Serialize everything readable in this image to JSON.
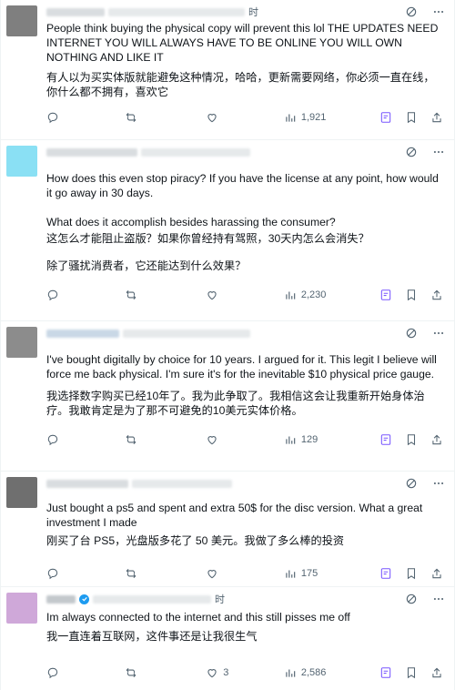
{
  "colors": {
    "icon": "#536471",
    "grok_highlight": "#7856ff",
    "verified": "#1d9bf0",
    "avatar_1": "#7f7f7f",
    "avatar_2": "#8ae0f4",
    "avatar_3": "#8c8c8c",
    "avatar_4": "#6f6f6f",
    "avatar_5": "#cfa8d9"
  },
  "icons": {
    "reply": "reply-icon",
    "repost": "repost-icon",
    "like": "like-icon",
    "views": "views-icon",
    "grok": "grok-icon",
    "bookmark": "bookmark-icon",
    "share": "share-icon",
    "more": "more-icon"
  },
  "posts": [
    {
      "header_suffix": "时",
      "verified": false,
      "lines": [
        "People think buying the physical copy will prevent this lol THE UPDATES NEED INTERNET YOU WILL ALWAYS HAVE TO BE ONLINE YOU WILL OWN NOTHING AND LIKE IT",
        "有人以为买实体版就能避免这种情况，哈哈，更新需要网络，你必须一直在线，你什么都不拥有，喜欢它"
      ],
      "likes": "",
      "views": "1,921"
    },
    {
      "header_suffix": "",
      "verified": false,
      "lines": [
        "How does this even stop piracy? If you have the license at any point, how would it go away in 30 days.",
        "What does it accomplish besides harassing the consumer?",
        "这怎么才能阻止盗版？如果你曾经持有驾照，30天内怎么会消失？",
        "除了骚扰消费者，它还能达到什么效果？"
      ],
      "likes": "",
      "views": "2,230"
    },
    {
      "header_suffix": "",
      "verified": false,
      "lines": [
        "I've bought digitally by choice for 10 years. I argued for it. This legit I believe will force me back physical. I'm sure it's for the inevitable $10 physical price gauge.",
        "我选择数字购买已经10年了。我为此争取了。我相信这会让我重新开始身体治疗。我敢肯定是为了那不可避免的10美元实体价格。"
      ],
      "likes": "",
      "views": "129"
    },
    {
      "header_suffix": "",
      "verified": false,
      "lines": [
        "Just bought a ps5 and spent and extra 50$ for the disc version. What a great investment I made",
        "刚买了台 PS5，光盘版多花了 50 美元。我做了多么棒的投资"
      ],
      "likes": "",
      "views": "175"
    },
    {
      "header_suffix": "时",
      "verified": true,
      "lines": [
        "Im always connected to the internet and this still pisses me off",
        "我一直连着互联网，这件事还是让我很生气"
      ],
      "likes": "3",
      "views": "2,586"
    }
  ]
}
